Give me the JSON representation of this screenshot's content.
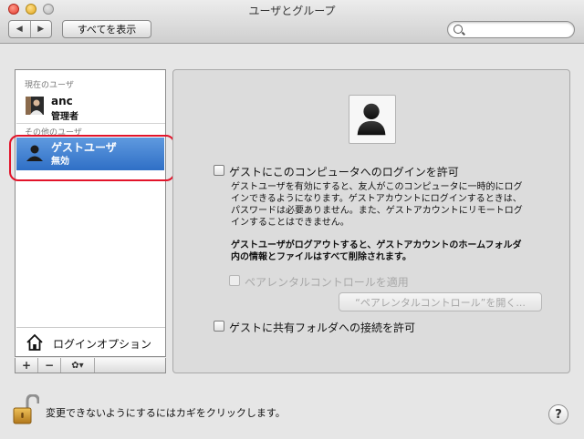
{
  "window": {
    "title": "ユーザとグループ"
  },
  "toolbar": {
    "back_glyph": "◀",
    "forward_glyph": "▶",
    "show_all_label": "すべてを表示",
    "search_placeholder": ""
  },
  "sidebar": {
    "current_user_header": "現在のユーザ",
    "current_user": {
      "name": "anc",
      "role": "管理者"
    },
    "other_users_header": "その他のユーザ",
    "guest_user": {
      "name": "ゲストユーザ",
      "status": "無効"
    },
    "login_options_label": "ログインオプション",
    "add_glyph": "+",
    "remove_glyph": "−",
    "action_glyph": "✿▾"
  },
  "panel": {
    "allow_guest_login": {
      "label": "ゲストにこのコンピュータへのログインを許可",
      "checked": false
    },
    "guest_description_lines": [
      "ゲストユーザを有効にすると、友人がこのコンピュータに一時的にログ",
      "インできるようになります。ゲストアカウントにログインするときは、",
      "パスワードは必要ありません。また、ゲストアカウントにリモートログ",
      "インすることはできません。"
    ],
    "guest_warning_lines": [
      "ゲストユーザがログアウトすると、ゲストアカウントのホームフォルダ",
      "内の情報とファイルはすべて削除されます。"
    ],
    "parental_controls_checkbox": {
      "label": "ペアレンタルコントロールを適用",
      "checked": false,
      "disabled": true
    },
    "open_parental_controls_button": "“ペアレンタルコントロール”を開く...",
    "allow_shared_folders": {
      "label": "ゲストに共有フォルダへの接続を許可",
      "checked": false
    }
  },
  "footer": {
    "lock_message": "変更できないようにするにはカギをクリックします。",
    "help_label": "?"
  },
  "colors": {
    "selection_blue": "#2f6fc6",
    "annotation_red": "#e2142a"
  }
}
